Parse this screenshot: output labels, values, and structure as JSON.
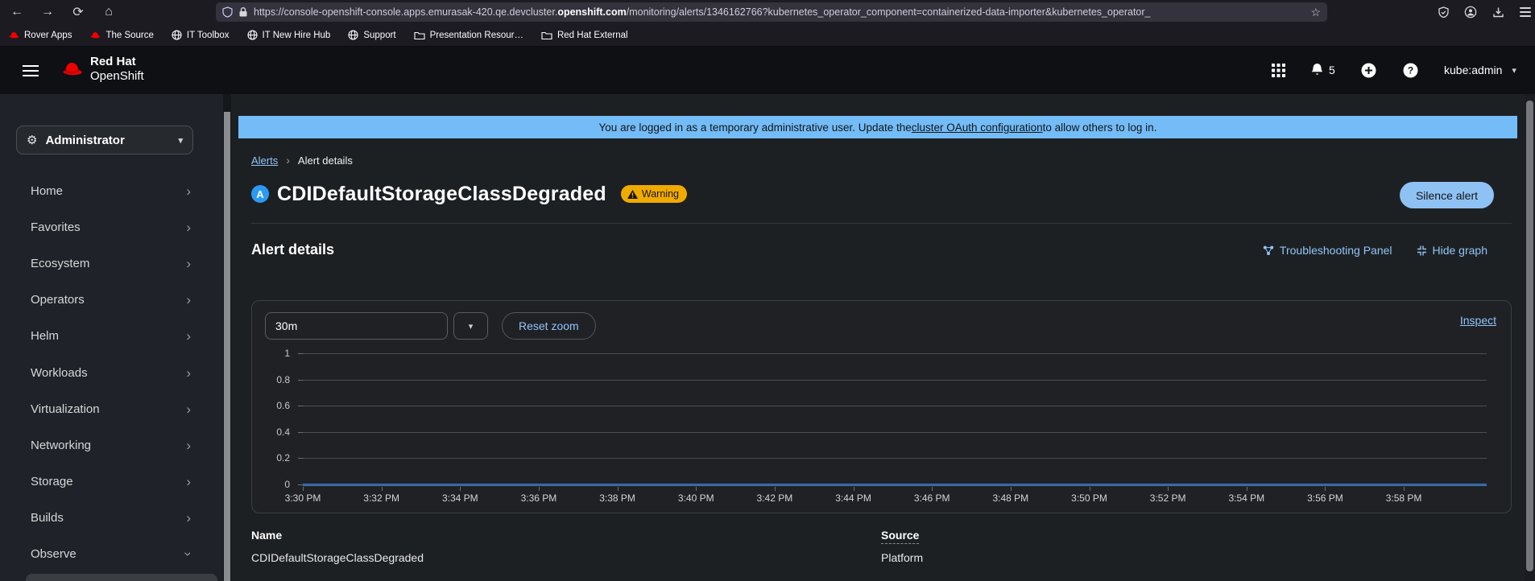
{
  "colors": {
    "banner_blue": "#73bcf7",
    "link_blue": "#92c5f9",
    "warning_amber": "#f0ab00",
    "severity_icon_bg": "#2b9af3",
    "series_line": "#2f7fe0"
  },
  "browser": {
    "url_pre": "https://console-openshift-console.apps.emurasak-420.qe.devcluster.",
    "url_domain": "openshift.com",
    "url_path": "/monitoring/alerts/1346162766?kubernetes_operator_component=containerized-data-importer&kubernetes_operator_",
    "bookmarks": [
      {
        "label": "Rover Apps",
        "icon": "redhat"
      },
      {
        "label": "The Source",
        "icon": "redhat"
      },
      {
        "label": "IT Toolbox",
        "icon": "globe"
      },
      {
        "label": "IT New Hire Hub",
        "icon": "globe"
      },
      {
        "label": "Support",
        "icon": "globe"
      },
      {
        "label": "Presentation Resour…",
        "icon": "folder"
      },
      {
        "label": "Red Hat External",
        "icon": "folder"
      }
    ]
  },
  "masthead": {
    "brand_top": "Red Hat",
    "brand_bottom": "OpenShift",
    "notification_count": "5",
    "user": "kube:admin"
  },
  "sidebar": {
    "perspective": "Administrator",
    "items": [
      {
        "label": "Home"
      },
      {
        "label": "Favorites"
      },
      {
        "label": "Ecosystem"
      },
      {
        "label": "Operators"
      },
      {
        "label": "Helm"
      },
      {
        "label": "Workloads"
      },
      {
        "label": "Virtualization"
      },
      {
        "label": "Networking"
      },
      {
        "label": "Storage"
      },
      {
        "label": "Builds"
      },
      {
        "label": "Observe",
        "expanded": true
      }
    ]
  },
  "banner": {
    "text_before": "You are logged in as a temporary administrative user. Update the ",
    "link_text": "cluster OAuth configuration",
    "text_after": " to allow others to log in."
  },
  "breadcrumb": {
    "parent": "Alerts",
    "current": "Alert details"
  },
  "alert": {
    "severity_letter": "A",
    "title": "CDIDefaultStorageClassDegraded",
    "severity_label": "Warning",
    "silence_button_label": "Silence alert"
  },
  "section": {
    "heading": "Alert details",
    "troubleshooting_link": "Troubleshooting Panel",
    "hide_graph_link": "Hide graph"
  },
  "graph_toolbar": {
    "timespan_value": "30m",
    "reset_zoom_label": "Reset zoom",
    "inspect_link": "Inspect"
  },
  "fields": {
    "name_label": "Name",
    "name_value": "CDIDefaultStorageClassDegraded",
    "source_label": "Source",
    "source_value": "Platform"
  },
  "chart_data": {
    "type": "line",
    "title": "",
    "x": [
      "3:30 PM",
      "3:32 PM",
      "3:34 PM",
      "3:36 PM",
      "3:38 PM",
      "3:40 PM",
      "3:42 PM",
      "3:44 PM",
      "3:46 PM",
      "3:48 PM",
      "3:50 PM",
      "3:52 PM",
      "3:54 PM",
      "3:56 PM",
      "3:58 PM"
    ],
    "series": [
      {
        "name": "CDIDefaultStorageClassDegraded",
        "values": [
          0,
          0,
          0,
          0,
          0,
          0,
          0,
          0,
          0,
          0,
          0,
          0,
          0,
          0,
          0
        ]
      }
    ],
    "ylim": [
      0,
      1
    ],
    "y_ticks": [
      "1",
      "0.8",
      "0.6",
      "0.4",
      "0.2",
      "0"
    ],
    "grid": true,
    "legend": "none",
    "x_span_pct": 93,
    "line_color": "#2f7fe0"
  }
}
